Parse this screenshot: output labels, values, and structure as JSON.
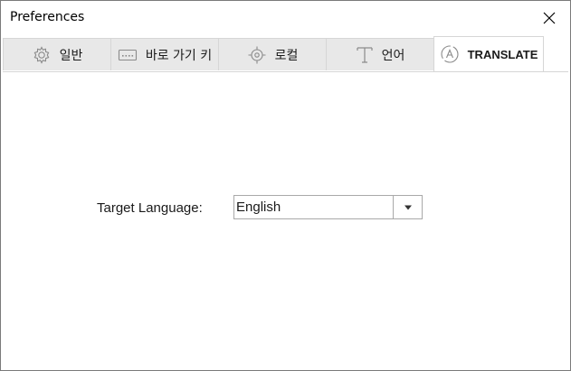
{
  "window": {
    "title": "Preferences",
    "close_icon": "close-icon"
  },
  "tabs": [
    {
      "label": "일반",
      "icon": "gear-icon",
      "active": false
    },
    {
      "label": "바로 가기 키",
      "icon": "keyboard-icon",
      "active": false
    },
    {
      "label": "로컬",
      "icon": "location-target-icon",
      "active": false
    },
    {
      "label": "언어",
      "icon": "text-t-icon",
      "active": false
    },
    {
      "label": "TRANSLATE",
      "icon": "translate-a-icon",
      "active": true
    }
  ],
  "translate": {
    "target_language_label": "Target Language:",
    "target_language_value": "English",
    "dropdown_icon": "chevron-down-icon"
  },
  "colors": {
    "tab_inactive_bg": "#e8e8e8",
    "tab_active_bg": "#ffffff",
    "border": "#d6d6d6",
    "window_border": "#7a7a7a"
  }
}
